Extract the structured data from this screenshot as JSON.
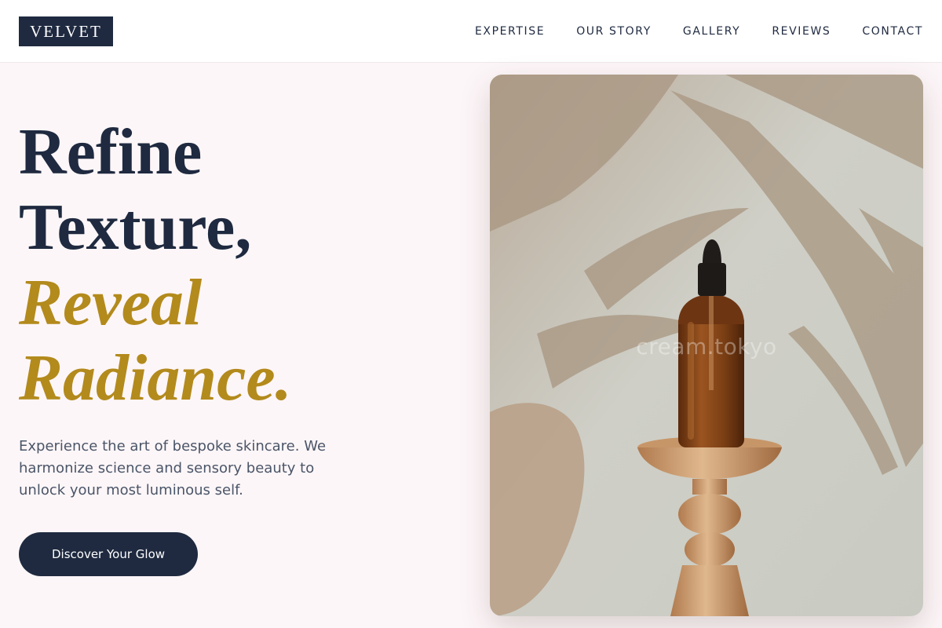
{
  "brand": {
    "logo": "VELVET"
  },
  "nav": {
    "items": [
      {
        "label": "EXPERTISE"
      },
      {
        "label": "OUR STORY"
      },
      {
        "label": "GALLERY"
      },
      {
        "label": "REVIEWS"
      },
      {
        "label": "CONTACT"
      }
    ]
  },
  "hero": {
    "title_line1": "Refine",
    "title_line2": "Texture,",
    "title_line3": "Reveal",
    "title_line4": "Radiance.",
    "description": "Experience the art of bespoke skincare. We harmonize science and sensory beauty to unlock your most luminous self.",
    "cta_label": "Discover Your Glow"
  },
  "image": {
    "watermark": "cream.tokyo"
  },
  "colors": {
    "navy": "#1f2a40",
    "gold": "#b38a1c",
    "background": "#fdf6f8"
  }
}
